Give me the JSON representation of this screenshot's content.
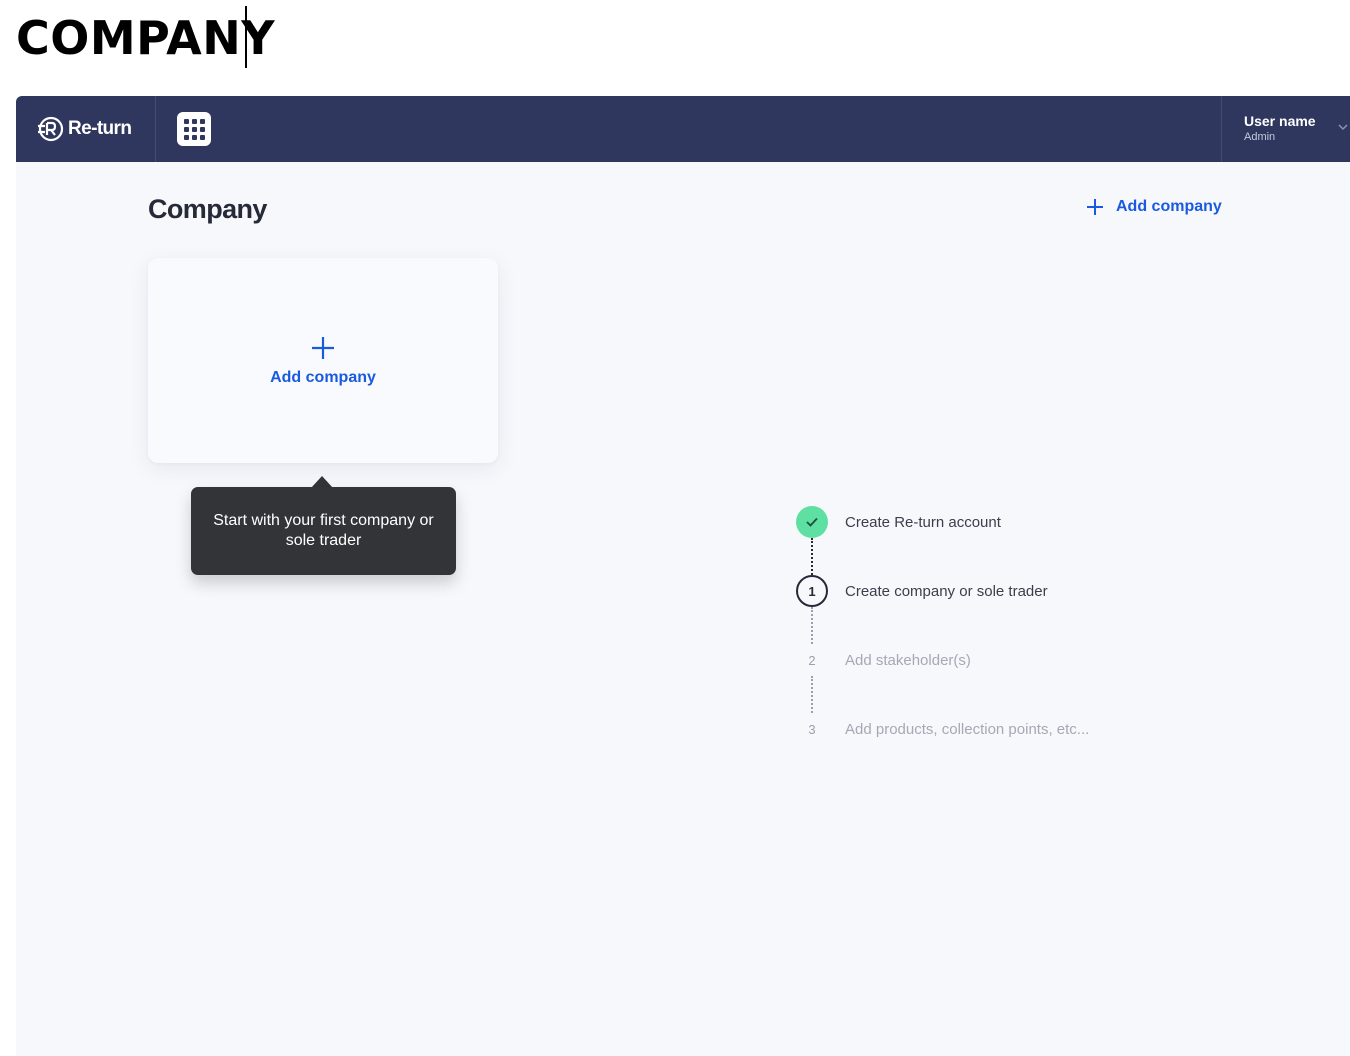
{
  "doc_heading": "COMPANY",
  "topbar": {
    "brand": "Re-turn",
    "user": {
      "name": "User name",
      "role": "Admin"
    }
  },
  "page": {
    "title": "Company",
    "add_company_link": "Add company"
  },
  "card": {
    "label": "Add company"
  },
  "tooltip": {
    "text": "Start with your first company or sole trader"
  },
  "steps": [
    {
      "marker": "",
      "label": "Create Re-turn account",
      "status": "complete"
    },
    {
      "marker": "1",
      "label": "Create company or sole trader",
      "status": "current"
    },
    {
      "marker": "2",
      "label": "Add stakeholder(s)",
      "status": "pending"
    },
    {
      "marker": "3",
      "label": "Add products, collection points, etc...",
      "status": "pending"
    }
  ],
  "colors": {
    "topbar": "#2f375e",
    "accent": "#1a5ae0",
    "complete": "#5de0a2",
    "tooltip": "#333438",
    "background": "#f7f8fc"
  },
  "icons": [
    "return-logo-icon",
    "apps-grid-icon",
    "chevron-down-icon",
    "plus-icon",
    "check-icon"
  ]
}
